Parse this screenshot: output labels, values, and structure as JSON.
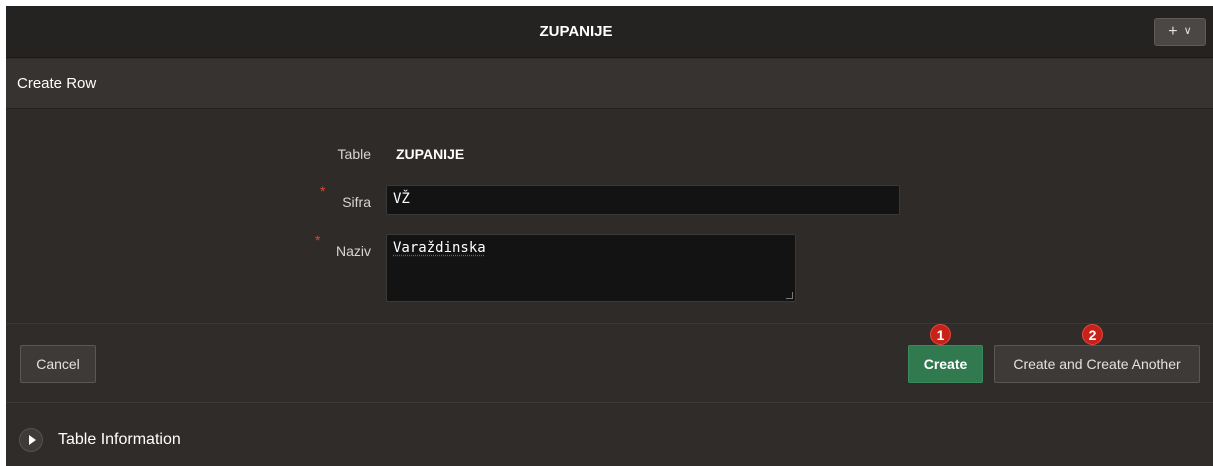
{
  "header": {
    "title": "ZUPANIJE",
    "add_menu": {
      "plus": "+",
      "chevron": "∨"
    }
  },
  "region": {
    "title": "Create Row"
  },
  "form": {
    "table_label": "Table",
    "table_value": "ZUPANIJE",
    "required_marker": "*",
    "sifra_label": "Sifra",
    "sifra_value": "VŽ",
    "naziv_label": "Naziv",
    "naziv_value": "Varaždinska"
  },
  "buttons": {
    "cancel": "Cancel",
    "create": "Create",
    "create_another": "Create and Create Another"
  },
  "annotations": {
    "badge_1": "1",
    "badge_2": "2"
  },
  "table_information": {
    "title": "Table Information"
  },
  "colors": {
    "background": "#2f2c2a",
    "primary_button": "#317a4f",
    "required": "#e0463c",
    "badge": "#c7211a"
  }
}
